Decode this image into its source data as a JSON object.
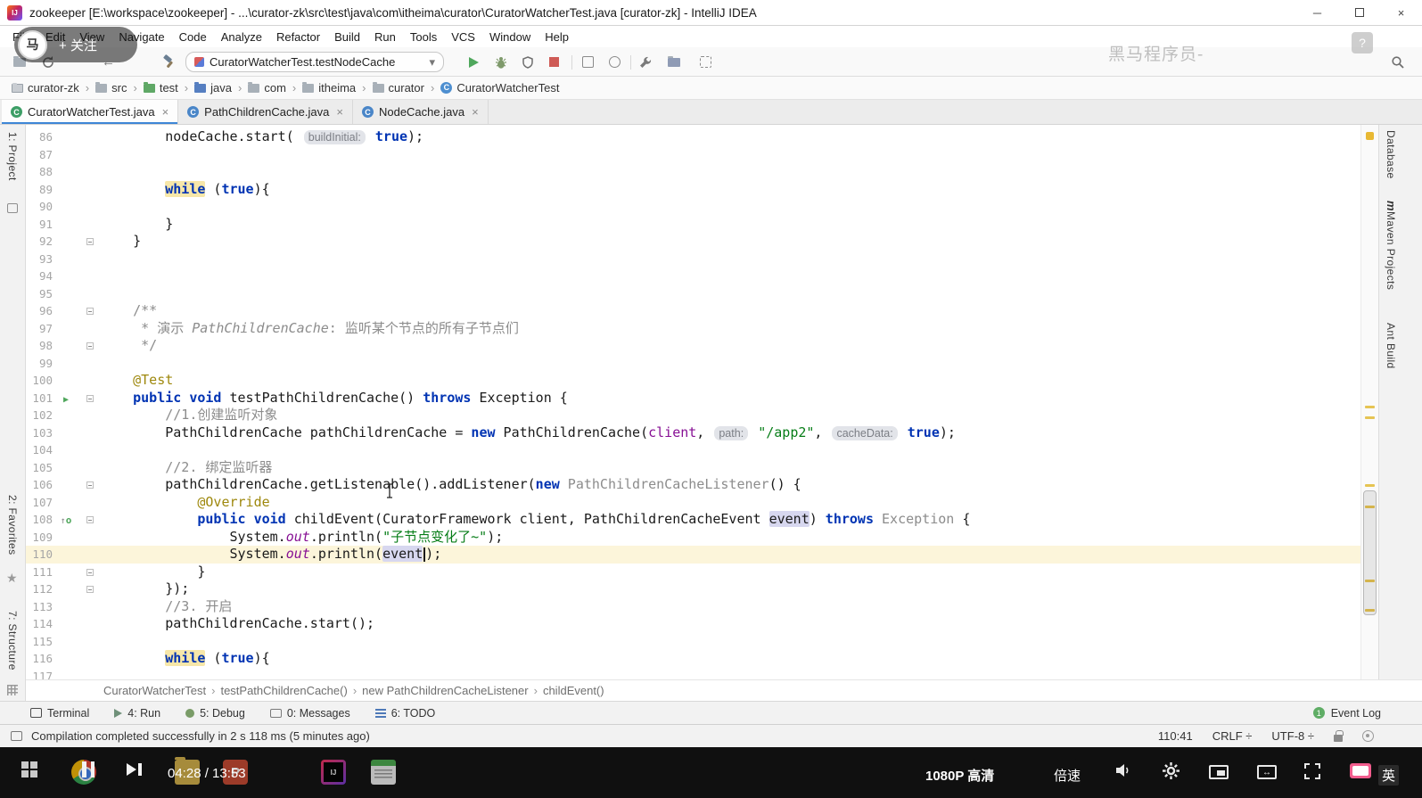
{
  "window": {
    "title": "zookeeper [E:\\workspace\\zookeeper] - ...\\curator-zk\\src\\test\\java\\com\\itheima\\curator\\CuratorWatcherTest.java [curator-zk] - IntelliJ IDEA"
  },
  "icons": {
    "minimize": "─",
    "close": "×",
    "tab_close": "×",
    "dropdown": "▾",
    "back": "←",
    "star": "★",
    "run_arrow": "▶",
    "override_letter": "o",
    "override_arrow": "↑",
    "maven_letter": "m",
    "class_letter": "C",
    "help": "?",
    "wide_arrows": "↔"
  },
  "overlay": {
    "avatar_text": "马",
    "follow_label": "+ 关注",
    "watermark": "黑马程序员-"
  },
  "menu": {
    "items": [
      "File",
      "Edit",
      "View",
      "Navigate",
      "Code",
      "Analyze",
      "Refactor",
      "Build",
      "Run",
      "Tools",
      "VCS",
      "Window",
      "Help"
    ]
  },
  "toolbar": {
    "run_config": "CuratorWatcherTest.testNodeCache"
  },
  "path_bar": {
    "separator": "›",
    "items": [
      {
        "label": "curator-zk",
        "icon": "module"
      },
      {
        "label": "src",
        "icon": "folder"
      },
      {
        "label": "test",
        "icon": "folder-test"
      },
      {
        "label": "java",
        "icon": "folder-src"
      },
      {
        "label": "com",
        "icon": "folder"
      },
      {
        "label": "itheima",
        "icon": "folder"
      },
      {
        "label": "curator",
        "icon": "folder"
      },
      {
        "label": "CuratorWatcherTest",
        "icon": "class"
      }
    ]
  },
  "tabs": [
    {
      "label": "CuratorWatcherTest.java",
      "active": true,
      "icon_color": "#3c9e66"
    },
    {
      "label": "PathChildrenCache.java",
      "active": false,
      "icon_color": "#4a86c8"
    },
    {
      "label": "NodeCache.java",
      "active": false,
      "icon_color": "#4a86c8"
    }
  ],
  "left_stripe": [
    "1: Project",
    "2: Favorites",
    "7: Structure"
  ],
  "right_stripe": [
    "Database",
    "Maven Projects",
    "Ant Build"
  ],
  "editor": {
    "current_line": 110,
    "run_line": 101,
    "override_line": 108,
    "fold_lines": [
      92,
      96,
      98,
      101,
      106,
      108,
      111,
      112
    ],
    "lines": [
      {
        "num": 86,
        "segs": [
          {
            "c": "plain",
            "t": "        nodeCache.start( "
          },
          {
            "c": "hint",
            "t": "buildInitial:"
          },
          {
            "c": "plain",
            "t": " "
          },
          {
            "c": "kw",
            "t": "true"
          },
          {
            "c": "plain",
            "t": ");"
          }
        ]
      },
      {
        "num": 87,
        "segs": []
      },
      {
        "num": 88,
        "segs": []
      },
      {
        "num": 89,
        "segs": [
          {
            "c": "plain",
            "t": "        "
          },
          {
            "c": "kwhl",
            "t": "while"
          },
          {
            "c": "plain",
            "t": " ("
          },
          {
            "c": "kw",
            "t": "true"
          },
          {
            "c": "plain",
            "t": "){"
          }
        ]
      },
      {
        "num": 90,
        "segs": []
      },
      {
        "num": 91,
        "segs": [
          {
            "c": "plain",
            "t": "        }"
          }
        ]
      },
      {
        "num": 92,
        "segs": [
          {
            "c": "plain",
            "t": "    }"
          }
        ]
      },
      {
        "num": 93,
        "segs": []
      },
      {
        "num": 94,
        "segs": []
      },
      {
        "num": 95,
        "segs": []
      },
      {
        "num": 96,
        "segs": [
          {
            "c": "doc",
            "t": "    /**"
          }
        ]
      },
      {
        "num": 97,
        "segs": [
          {
            "c": "doc",
            "t": "     * 演示 "
          },
          {
            "c": "doci",
            "t": "PathChildrenCache"
          },
          {
            "c": "doc",
            "t": ": 监听某个节点的所有子节点们"
          }
        ]
      },
      {
        "num": 98,
        "segs": [
          {
            "c": "doc",
            "t": "     */"
          }
        ]
      },
      {
        "num": 99,
        "segs": []
      },
      {
        "num": 100,
        "segs": [
          {
            "c": "ann",
            "t": "    @Test"
          }
        ]
      },
      {
        "num": 101,
        "segs": [
          {
            "c": "plain",
            "t": "    "
          },
          {
            "c": "kw",
            "t": "public"
          },
          {
            "c": "plain",
            "t": " "
          },
          {
            "c": "kw",
            "t": "void"
          },
          {
            "c": "plain",
            "t": " testPathChildrenCache() "
          },
          {
            "c": "kw",
            "t": "throws"
          },
          {
            "c": "plain",
            "t": " Exception {"
          }
        ]
      },
      {
        "num": 102,
        "segs": [
          {
            "c": "cmt",
            "t": "        //1.创建监听对象"
          }
        ]
      },
      {
        "num": 103,
        "segs": [
          {
            "c": "plain",
            "t": "        PathChildrenCache pathChildrenCache = "
          },
          {
            "c": "kw",
            "t": "new"
          },
          {
            "c": "plain",
            "t": " PathChildrenCache("
          },
          {
            "c": "field",
            "t": "client"
          },
          {
            "c": "plain",
            "t": ", "
          },
          {
            "c": "hint",
            "t": "path:"
          },
          {
            "c": "plain",
            "t": " "
          },
          {
            "c": "str",
            "t": "\"/app2\""
          },
          {
            "c": "plain",
            "t": ", "
          },
          {
            "c": "hint",
            "t": "cacheData:"
          },
          {
            "c": "plain",
            "t": " "
          },
          {
            "c": "kw",
            "t": "true"
          },
          {
            "c": "plain",
            "t": ");"
          }
        ]
      },
      {
        "num": 104,
        "segs": []
      },
      {
        "num": 105,
        "segs": [
          {
            "c": "cmt",
            "t": "        //2. 绑定监听器"
          }
        ]
      },
      {
        "num": 106,
        "segs": [
          {
            "c": "plain",
            "t": "        pathChildrenCache.getListenable().addListener("
          },
          {
            "c": "kw",
            "t": "new"
          },
          {
            "c": "plain",
            "t": " "
          },
          {
            "c": "grey",
            "t": "PathChildrenCacheListener"
          },
          {
            "c": "plain",
            "t": "() {"
          }
        ]
      },
      {
        "num": 107,
        "segs": [
          {
            "c": "ann",
            "t": "            @Override"
          }
        ]
      },
      {
        "num": 108,
        "segs": [
          {
            "c": "plain",
            "t": "            "
          },
          {
            "c": "kw",
            "t": "public"
          },
          {
            "c": "plain",
            "t": " "
          },
          {
            "c": "kw",
            "t": "void"
          },
          {
            "c": "plain",
            "t": " childEvent(CuratorFramework client, PathChildrenCacheEvent "
          },
          {
            "c": "identhl",
            "t": "event"
          },
          {
            "c": "plain",
            "t": ") "
          },
          {
            "c": "kw",
            "t": "throws"
          },
          {
            "c": "plain",
            "t": " "
          },
          {
            "c": "grey",
            "t": "Exception"
          },
          {
            "c": "plain",
            "t": " {"
          }
        ]
      },
      {
        "num": 109,
        "segs": [
          {
            "c": "plain",
            "t": "                System."
          },
          {
            "c": "fieldi",
            "t": "out"
          },
          {
            "c": "plain",
            "t": ".println("
          },
          {
            "c": "str",
            "t": "\"子节点变化了~\""
          },
          {
            "c": "plain",
            "t": ");"
          }
        ]
      },
      {
        "num": 110,
        "segs": [
          {
            "c": "plain",
            "t": "                System."
          },
          {
            "c": "fieldi",
            "t": "out"
          },
          {
            "c": "plain",
            "t": ".println("
          },
          {
            "c": "identhl",
            "t": "event"
          },
          {
            "c": "caret",
            "t": ""
          },
          {
            "c": "plain",
            "t": ");"
          }
        ]
      },
      {
        "num": 111,
        "segs": [
          {
            "c": "plain",
            "t": "            }"
          }
        ]
      },
      {
        "num": 112,
        "segs": [
          {
            "c": "plain",
            "t": "        });"
          }
        ]
      },
      {
        "num": 113,
        "segs": [
          {
            "c": "cmt",
            "t": "        //3. 开启"
          }
        ]
      },
      {
        "num": 114,
        "segs": [
          {
            "c": "plain",
            "t": "        pathChildrenCache.start();"
          }
        ]
      },
      {
        "num": 115,
        "segs": []
      },
      {
        "num": 116,
        "segs": [
          {
            "c": "plain",
            "t": "        "
          },
          {
            "c": "kwhl",
            "t": "while"
          },
          {
            "c": "plain",
            "t": " ("
          },
          {
            "c": "kw",
            "t": "true"
          },
          {
            "c": "plain",
            "t": "){"
          }
        ]
      },
      {
        "num": 117,
        "segs": []
      }
    ]
  },
  "breadcrumbs": {
    "separator": "›",
    "items": [
      "CuratorWatcherTest",
      "testPathChildrenCache()",
      "new PathChildrenCacheListener",
      "childEvent()"
    ]
  },
  "tool_bar": {
    "buttons": [
      "Terminal",
      "4: Run",
      "5: Debug",
      "0: Messages",
      "6: TODO"
    ],
    "event_log": "Event Log",
    "event_log_badge": "1"
  },
  "status_bar": {
    "message": "Compilation completed successfully in 2 s 118 ms (5 minutes ago)",
    "caret_position": "110:41",
    "line_separator": "CRLF ÷",
    "encoding": "UTF-8 ÷"
  },
  "player": {
    "time": "04:28 / 13:53",
    "quality": "1080P 高清",
    "speed": "倍速",
    "ime": "英"
  }
}
